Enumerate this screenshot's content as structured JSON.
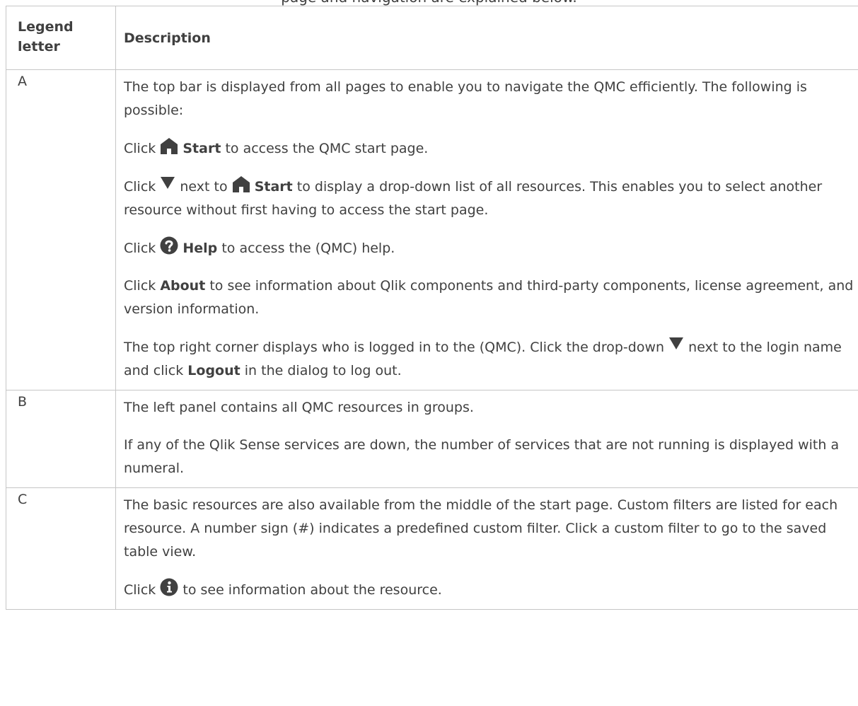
{
  "caption": "page and navigation are explained below.",
  "table": {
    "headers": {
      "legend_letter": "Legend letter",
      "description": "Description"
    },
    "rows": [
      {
        "letter": "A",
        "paragraphs": [
          {
            "text": "The top bar is displayed from all pages to enable you to navigate the QMC efficiently. The following is possible:"
          },
          {
            "pre": "Click",
            "icon": "home-icon",
            "bold": "Start",
            "post": "to access the QMC start page."
          },
          {
            "pre": "Click",
            "icon1": "caret-down-icon",
            "mid": "next to",
            "icon2": "home-icon",
            "bold": "Start",
            "post": "to display a drop-down list of all resources. This enables you to select another resource without first having to access the start page."
          },
          {
            "pre": "Click",
            "icon": "help-circle-icon",
            "bold": "Help",
            "post": "to access the (QMC) help."
          },
          {
            "pre": "Click",
            "bold": "About",
            "post": "to see information about Qlik components and third-party components, license agreement, and version information."
          },
          {
            "pre": "The top right corner displays who is logged in to the (QMC). Click the drop-down",
            "icon": "caret-down-icon",
            "mid": "next to the login name and click",
            "bold": "Logout",
            "post": "in the dialog to log out."
          }
        ]
      },
      {
        "letter": "B",
        "paragraphs": [
          {
            "text": "The left panel contains all QMC resources in groups."
          },
          {
            "text": "If any of the Qlik Sense services are down, the number of services that are not running is displayed with a numeral."
          }
        ]
      },
      {
        "letter": "C",
        "paragraphs": [
          {
            "text": "The basic resources are also available from the middle of the start page. Custom filters are listed for each resource. A number sign (#) indicates a predefined custom filter. Click a custom filter to go to the saved table view."
          },
          {
            "pre": "Click",
            "icon": "info-circle-icon",
            "post": "to see information about the resource."
          }
        ]
      }
    ]
  }
}
